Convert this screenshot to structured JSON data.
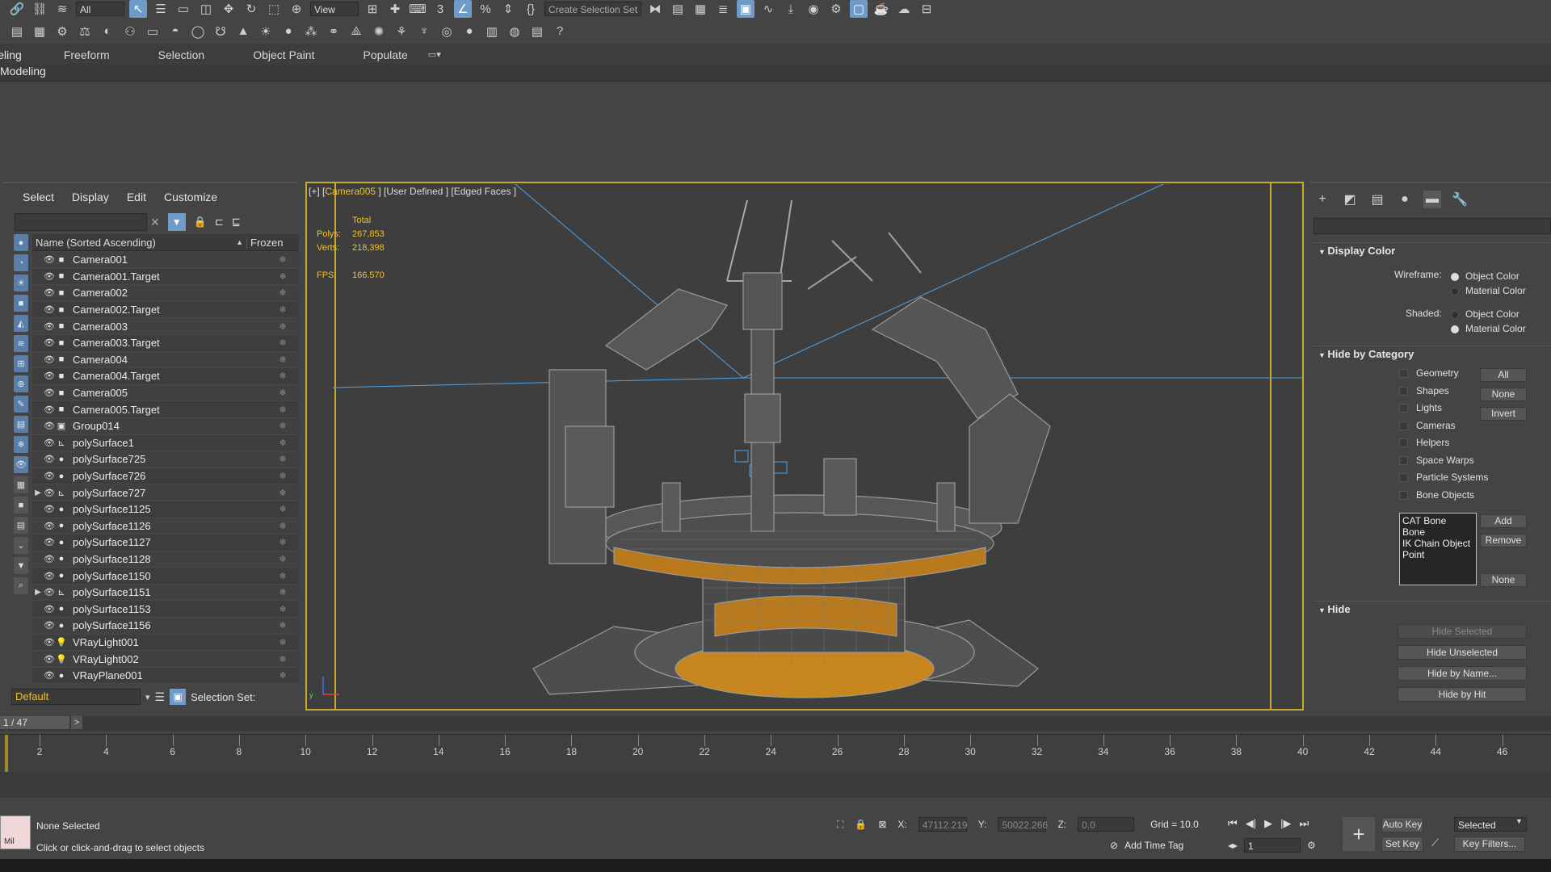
{
  "colors": {
    "accent": "#6e9bc8",
    "viewport_border": "#c8a92c",
    "highlight_text": "#f0c030"
  },
  "toolbar": {
    "view_dropdown": "View",
    "selection_set_placeholder": "Create Selection Set",
    "filter_dropdown": "All"
  },
  "ribbon": {
    "tabs": [
      "Modeling",
      "Freeform",
      "Selection",
      "Object Paint",
      "Populate"
    ],
    "sub_label": "Modeling"
  },
  "explorer": {
    "menu": [
      "Select",
      "Display",
      "Edit",
      "Customize"
    ],
    "columns": {
      "name": "Name (Sorted Ascending)",
      "frozen": "Frozen"
    },
    "rows": [
      {
        "name": "Camera001",
        "type": "camera-icon",
        "expandable": false
      },
      {
        "name": "Camera001.Target",
        "type": "camera-icon",
        "expandable": false
      },
      {
        "name": "Camera002",
        "type": "camera-icon",
        "expandable": false
      },
      {
        "name": "Camera002.Target",
        "type": "camera-icon",
        "expandable": false
      },
      {
        "name": "Camera003",
        "type": "camera-icon",
        "expandable": false
      },
      {
        "name": "Camera003.Target",
        "type": "camera-icon",
        "expandable": false
      },
      {
        "name": "Camera004",
        "type": "camera-icon",
        "expandable": false
      },
      {
        "name": "Camera004.Target",
        "type": "camera-icon",
        "expandable": false
      },
      {
        "name": "Camera005",
        "type": "camera-icon",
        "expandable": false
      },
      {
        "name": "Camera005.Target",
        "type": "camera-icon",
        "expandable": false
      },
      {
        "name": "Group014",
        "type": "group-icon",
        "expandable": false
      },
      {
        "name": "polySurface1",
        "type": "bone-icon",
        "expandable": false
      },
      {
        "name": "polySurface725",
        "type": "geometry-icon",
        "expandable": false
      },
      {
        "name": "polySurface726",
        "type": "geometry-icon",
        "expandable": false
      },
      {
        "name": "polySurface727",
        "type": "bone-icon",
        "expandable": true
      },
      {
        "name": "polySurface1125",
        "type": "geometry-icon",
        "expandable": false
      },
      {
        "name": "polySurface1126",
        "type": "geometry-icon",
        "expandable": false
      },
      {
        "name": "polySurface1127",
        "type": "geometry-icon",
        "expandable": false
      },
      {
        "name": "polySurface1128",
        "type": "geometry-icon",
        "expandable": false
      },
      {
        "name": "polySurface1150",
        "type": "geometry-icon",
        "expandable": false
      },
      {
        "name": "polySurface1151",
        "type": "bone-icon",
        "expandable": true
      },
      {
        "name": "polySurface1153",
        "type": "geometry-icon",
        "expandable": false
      },
      {
        "name": "polySurface1156",
        "type": "geometry-icon",
        "expandable": false
      },
      {
        "name": "VRayLight001",
        "type": "light-icon",
        "expandable": false
      },
      {
        "name": "VRayLight002",
        "type": "light-icon",
        "expandable": false
      },
      {
        "name": "VRayPlane001",
        "type": "geometry-icon",
        "expandable": false
      }
    ],
    "layer": "Default",
    "selection_set_label": "Selection Set:"
  },
  "viewport": {
    "label_prefix": "[+] [",
    "camera": "Camera005",
    "label_suffix": " ] [User Defined ] [Edged Faces ]",
    "stats": {
      "header": "Total",
      "polys_label": "Polys:",
      "polys": "267,853",
      "verts_label": "Verts:",
      "verts": "218,398",
      "fps_label": "FPS:",
      "fps": "166.570"
    }
  },
  "command_panel": {
    "display_color": {
      "title": "Display Color",
      "wireframe_label": "Wireframe:",
      "shaded_label": "Shaded:",
      "object_color": "Object Color",
      "material_color": "Material Color",
      "wireframe_selected": "Object Color",
      "shaded_selected": "Material Color"
    },
    "hide_by_category": {
      "title": "Hide by Category",
      "categories": [
        "Geometry",
        "Shapes",
        "Lights",
        "Cameras",
        "Helpers",
        "Space Warps",
        "Particle Systems",
        "Bone Objects"
      ],
      "buttons": [
        "All",
        "None",
        "Invert"
      ],
      "list": [
        "CAT Bone",
        "Bone",
        "IK Chain Object",
        "Point"
      ],
      "add": "Add",
      "remove": "Remove",
      "none": "None"
    },
    "hide": {
      "title": "Hide",
      "buttons": [
        "Hide Selected",
        "Hide Unselected",
        "Hide by Name...",
        "Hide by Hit"
      ]
    }
  },
  "timeline": {
    "frame_indicator": "1 / 47",
    "next": ">",
    "ticks": [
      2,
      4,
      6,
      8,
      10,
      12,
      14,
      16,
      18,
      20,
      22,
      24,
      26,
      28,
      30,
      32,
      34,
      36,
      38,
      40,
      42,
      44,
      46
    ]
  },
  "status": {
    "selection": "None Selected",
    "prompt": "Click or click-and-drag to select objects",
    "x_label": "X:",
    "x": "47112.219",
    "y_label": "Y:",
    "y": "50022.266",
    "z_label": "Z:",
    "z": "0.0",
    "grid": "Grid = 10.0",
    "add_time_tag": "Add Time Tag",
    "auto_key": "Auto Key",
    "set_key": "Set Key",
    "key_mode": "Selected",
    "frame": "1",
    "key_filters": "Key Filters...",
    "macro": "Mil"
  }
}
